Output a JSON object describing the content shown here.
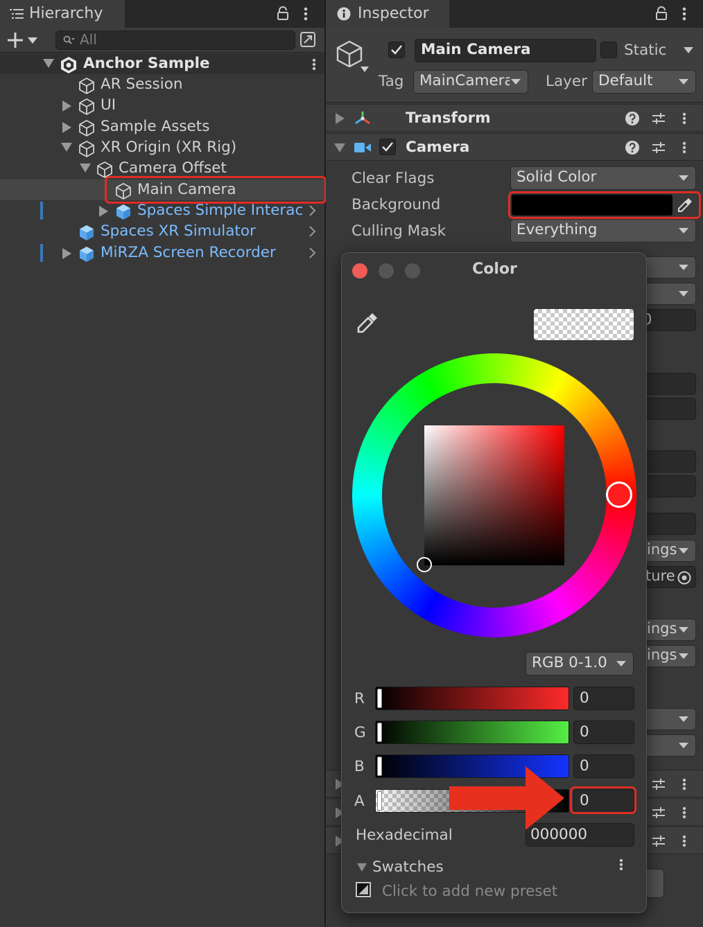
{
  "hierarchy": {
    "tab_label": "Hierarchy",
    "search_placeholder": "All",
    "scene": "Anchor Sample",
    "items": [
      {
        "label": "AR Session"
      },
      {
        "label": "UI"
      },
      {
        "label": "Sample Assets"
      },
      {
        "label": "XR Origin (XR Rig)"
      },
      {
        "label": "Camera Offset"
      },
      {
        "label": "Main Camera"
      },
      {
        "label": "Spaces Simple Interac"
      },
      {
        "label": "Spaces XR Simulator"
      },
      {
        "label": "MiRZA Screen Recorder"
      }
    ]
  },
  "inspector": {
    "tab_label": "Inspector",
    "object_name": "Main Camera",
    "static_label": "Static",
    "tag_label": "Tag",
    "tag_value": "MainCamera",
    "layer_label": "Layer",
    "layer_value": "Default",
    "transform_title": "Transform",
    "camera_title": "Camera",
    "clear_flags_label": "Clear Flags",
    "clear_flags_value": "Solid Color",
    "background_label": "Background",
    "culling_mask_label": "Culling Mask",
    "culling_mask_value": "Everything",
    "peek_texts": {
      "t1": "0",
      "t2": "ings",
      "t3": "ture",
      "t4": "ings",
      "t5": "ings"
    }
  },
  "color_picker": {
    "title": "Color",
    "mode": "RGB 0-1.0",
    "channels": [
      {
        "label": "R",
        "value": "0"
      },
      {
        "label": "G",
        "value": "0"
      },
      {
        "label": "B",
        "value": "0"
      },
      {
        "label": "A",
        "value": "0"
      }
    ],
    "hex_label": "Hexadecimal",
    "hex_value": "000000",
    "swatches_label": "Swatches",
    "swatches_hint": "Click to add new preset"
  },
  "colors": {
    "highlight_red": "#e02d24",
    "link_blue": "#7cbcff",
    "panel_bg": "#383838"
  }
}
